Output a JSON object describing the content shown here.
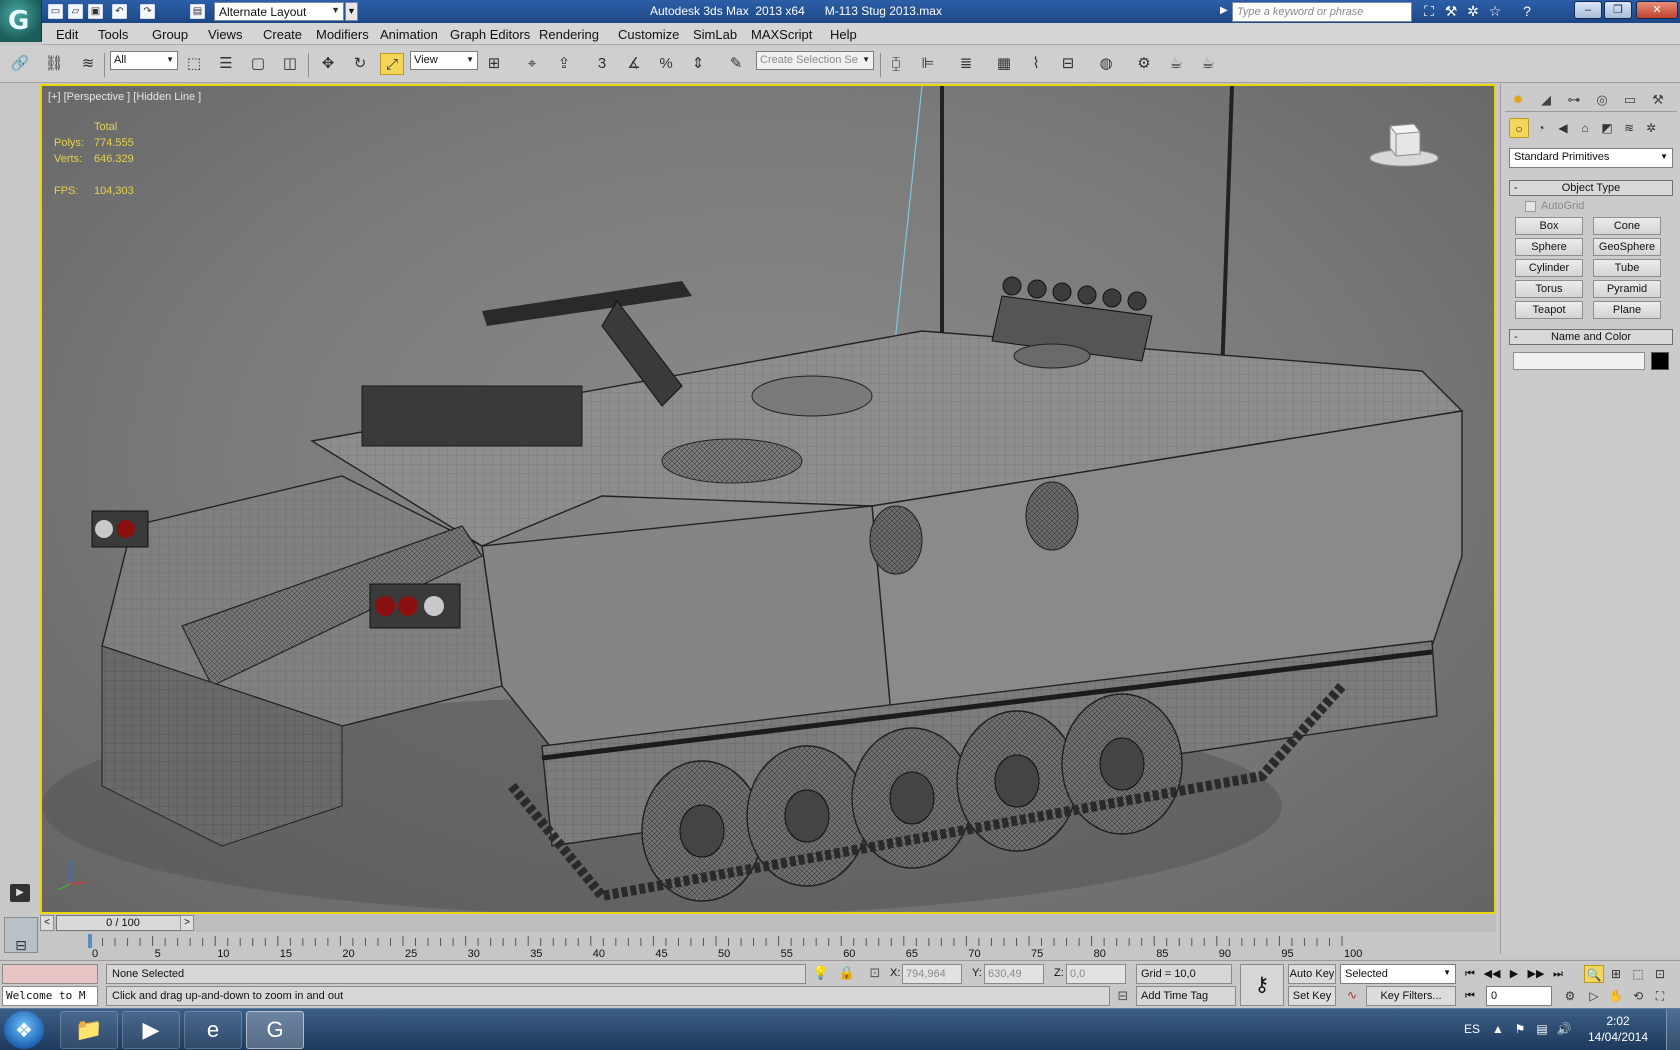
{
  "titlebar": {
    "app_name": "Autodesk 3ds Max  2013 x64",
    "file_name": "M-113 Stug 2013.max",
    "workspace": "Alternate Layout",
    "search_placeholder": "Type a keyword or phrase"
  },
  "menubar": {
    "items": [
      "Edit",
      "Tools",
      "Group",
      "Views",
      "Create",
      "Modifiers",
      "Animation",
      "Graph Editors",
      "Rendering",
      "Customize",
      "SimLab",
      "MAXScript",
      "Help"
    ]
  },
  "toolbar": {
    "selection_filter": "All",
    "reference_coord": "View",
    "named_selection_placeholder": "Create Selection Se"
  },
  "viewport": {
    "label": "[+] [Perspective ] [Hidden Line ]",
    "stats": {
      "header": "Total",
      "polys_label": "Polys:",
      "polys_value": "774.555",
      "verts_label": "Verts:",
      "verts_value": "646.329",
      "fps_label": "FPS:",
      "fps_value": "104,303"
    },
    "accent_color": "#e8d800"
  },
  "command_panel": {
    "category": "Standard Primitives",
    "object_type_title": "Object Type",
    "autogrid_label": "AutoGrid",
    "primitives": [
      "Box",
      "Cone",
      "Sphere",
      "GeoSphere",
      "Cylinder",
      "Tube",
      "Torus",
      "Pyramid",
      "Teapot",
      "Plane"
    ],
    "name_color_title": "Name and Color"
  },
  "timeline": {
    "slider_label": "0 / 100",
    "ticks": [
      "0",
      "5",
      "10",
      "15",
      "20",
      "25",
      "30",
      "35",
      "40",
      "45",
      "50",
      "55",
      "60",
      "65",
      "70",
      "75",
      "80",
      "85",
      "90",
      "95",
      "100"
    ]
  },
  "statusbar": {
    "maxscript_text": "Welcome to M",
    "selection": "None Selected",
    "prompt": "Click and drag up-and-down to zoom in and out",
    "x_label": "X:",
    "x_value": "794,964",
    "y_label": "Y:",
    "y_value": "630,49",
    "z_label": "Z:",
    "z_value": "0,0",
    "grid": "Grid = 10,0",
    "add_time_tag": "Add Time Tag",
    "auto_key": "Auto Key",
    "set_key": "Set Key",
    "key_mode": "Selected",
    "key_filters": "Key Filters...",
    "frame": "0"
  },
  "taskbar": {
    "language": "ES",
    "time": "2:02",
    "date": "14/04/2014"
  }
}
